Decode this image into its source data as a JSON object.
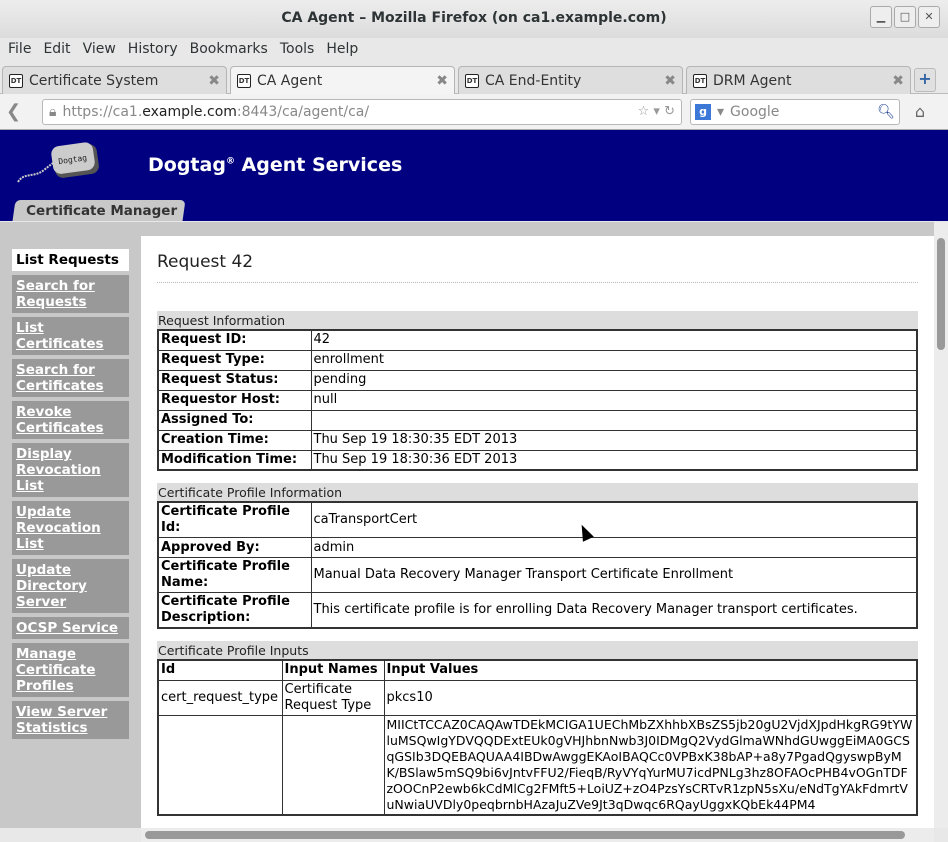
{
  "window": {
    "title": "CA Agent – Mozilla Firefox (on ca1.example.com)"
  },
  "menu": [
    "File",
    "Edit",
    "View",
    "History",
    "Bookmarks",
    "Tools",
    "Help"
  ],
  "tabs": [
    {
      "label": "Certificate System"
    },
    {
      "label": "CA Agent"
    },
    {
      "label": "CA End-Entity"
    },
    {
      "label": "DRM Agent"
    }
  ],
  "tab_favicon": "DT",
  "url": {
    "prefix": "https://ca1.",
    "host": "example.com",
    "suffix": ":8443/ca/agent/ca/"
  },
  "search": {
    "placeholder": "Google",
    "engine": "g"
  },
  "banner": {
    "logo_text": "Dogtag",
    "title": "Dogtag",
    "reg": "®",
    "title_rest": " Agent Services",
    "tab": "Certificate Manager",
    "bg": "#000080"
  },
  "sidebar": [
    {
      "label": "List Requests",
      "selected": true
    },
    {
      "label": "Search for Requests"
    },
    {
      "label": "List Certificates"
    },
    {
      "label": "Search for Certificates"
    },
    {
      "label": "Revoke Certificates"
    },
    {
      "label": "Display Revocation List"
    },
    {
      "label": "Update Revocation List"
    },
    {
      "label": "Update Directory Server"
    },
    {
      "label": "OCSP Service"
    },
    {
      "label": "Manage Certificate Profiles"
    },
    {
      "label": "View Server Statistics"
    }
  ],
  "page": {
    "title": "Request 42"
  },
  "request_info": {
    "heading": "Request Information",
    "rows": [
      {
        "k": "Request ID:",
        "v": "42"
      },
      {
        "k": "Request Type:",
        "v": "enrollment"
      },
      {
        "k": "Request Status:",
        "v": "pending"
      },
      {
        "k": "Requestor Host:",
        "v": "null"
      },
      {
        "k": "Assigned To:",
        "v": ""
      },
      {
        "k": "Creation Time:",
        "v": "Thu Sep 19 18:30:35 EDT 2013"
      },
      {
        "k": "Modification Time:",
        "v": "Thu Sep 19 18:30:36 EDT 2013"
      }
    ]
  },
  "profile_info": {
    "heading": "Certificate Profile Information",
    "rows": [
      {
        "k": "Certificate Profile Id:",
        "v": "caTransportCert"
      },
      {
        "k": "Approved By:",
        "v": "admin"
      },
      {
        "k": "Certificate Profile Name:",
        "v": "Manual Data Recovery Manager Transport Certificate Enrollment"
      },
      {
        "k": "Certificate Profile Description:",
        "v": "This certificate profile is for enrolling Data Recovery Manager transport certificates."
      }
    ]
  },
  "profile_inputs": {
    "heading": "Certificate Profile Inputs",
    "columns": [
      "Id",
      "Input Names",
      "Input Values"
    ],
    "rows": [
      {
        "id": "cert_request_type",
        "name": "Certificate Request Type",
        "value": "pkcs10"
      },
      {
        "id": "",
        "name": "",
        "value": "MIICtTCCAZ0CAQAwTDEkMCIGA1UEChMbZXhhbXBsZS5jb20gU2VjdXJpdHkgRG9tYWluMSQwIgYDVQQDExtEUk0gVHJhbnNwb3J0IDMgQ2VydGlmaWNhdGUwggEiMA0GCSqGSIb3DQEBAQUAA4IBDwAwggEKAoIBAQCc0VPBxK38bAP+a8y7PgadQgyswpByMK/BSlaw5mSQ9bi6vJntvFFU2/FieqB/RyVYqYurMU7icdPNLg3hz8OFAOcPHB4vOGnTDFzOOCnP2ewb6kCdMlCg2FMft5+LoiUZ+zO4PzsYsCRTvR1zpN5sXu/eNdTgYAkFdmrtVuNwiaUVDly0peqbrnbHAzaJuZVe9Jt3qDwqc6RQayUggxKQbEk44PM4"
      }
    ]
  }
}
